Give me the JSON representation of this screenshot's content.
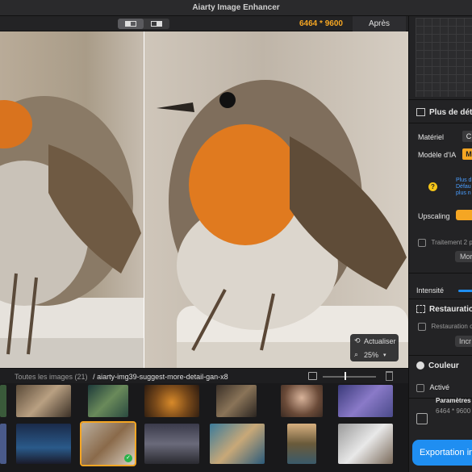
{
  "app": {
    "title": "Aiarty Image Enhancer"
  },
  "toolbar": {
    "dimensions": "6464 * 9600",
    "after_tab": "Après"
  },
  "zoom": {
    "refresh_label": "Actualiser",
    "level": "25%"
  },
  "sidebar": {
    "more_detail": "Plus de déta",
    "material_label": "Matériel",
    "material_value": "C",
    "model_label": "Modèle d'IA",
    "model_value": "M",
    "model_hint_1": "Plus d",
    "model_hint_2": "Défau",
    "model_hint_3": "plus n",
    "upscaling_label": "Upscaling",
    "treatment_label": "Traitement 2 p",
    "more_button": "Mor",
    "intensity_label": "Intensité",
    "restoration_title": "Restauration",
    "restoration_checkbox": "Restauration c",
    "incr_button": "Incr",
    "color_title": "Couleur",
    "active_label": "Activé",
    "output_params": "Paramètres d",
    "output_dims": "6464 * 9600"
  },
  "strip": {
    "all_images": "Toutes les images (21)",
    "path": "/ aiarty-img39-suggest-more-detail-gan-x8"
  },
  "export": {
    "label": "Exportation in"
  },
  "colors": {
    "accent": "#f5a623",
    "primary_blue": "#1f8ef1",
    "success": "#2bb34a"
  }
}
